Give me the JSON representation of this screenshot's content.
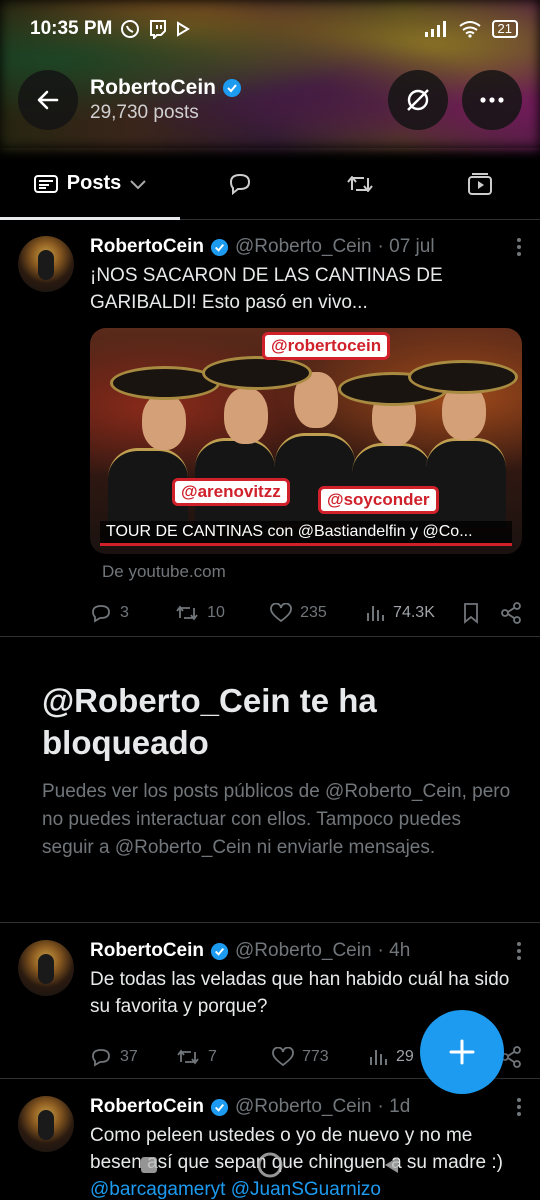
{
  "status_bar": {
    "time": "10:35 PM",
    "battery": "21",
    "icons": [
      "whatsapp-icon",
      "twitch-icon",
      "play-icon",
      "signal-icon",
      "wifi-icon",
      "battery-icon"
    ]
  },
  "profile": {
    "name": "RobertoCein",
    "posts_count": "29,730 posts"
  },
  "tabs": [
    {
      "label": "Posts",
      "icon": "feed-icon",
      "selected": true
    },
    {
      "label": "",
      "icon": "reply-icon"
    },
    {
      "label": "",
      "icon": "repost-icon"
    },
    {
      "label": "",
      "icon": "media-icon"
    }
  ],
  "posts": [
    {
      "name": "RobertoCein",
      "handle": "@Roberto_Cein",
      "time": "· 07 jul",
      "text": "¡NOS SACARON DE LAS CANTINAS DE GARIBALDI! Esto pasó en vivo...",
      "media": {
        "tag_top": "@robertocein",
        "tag_left": "@arenovitzz",
        "tag_right": "@soyconder",
        "caption": "TOUR DE CANTINAS con @Bastiandelfin y @Co...",
        "source": "De youtube.com"
      },
      "replies": "3",
      "reposts": "10",
      "likes": "235",
      "views": "74.3K"
    },
    {
      "name": "RobertoCein",
      "handle": "@Roberto_Cein",
      "time": "· 4h",
      "text": "De todas las veladas que han habido cuál ha sido su favorita y porque?",
      "replies": "37",
      "reposts": "7",
      "likes": "773",
      "views": "29"
    },
    {
      "name": "RobertoCein",
      "handle": "@Roberto_Cein",
      "time": "· 1d",
      "text_plain": "Como peleen ustedes o yo de nuevo y no me besen así que sepan que chinguen a su madre :) ",
      "mention_1": "@barcagameryt",
      "mention_2": "@JuanSGuarnizo"
    }
  ],
  "blocked": {
    "title": "@Roberto_Cein te ha bloqueado",
    "description": "Puedes ver los posts públicos de @Roberto_Cein, pero no puedes interactuar con ellos. Tampoco puedes seguir a @Roberto_Cein ni enviarle mensajes."
  },
  "colors": {
    "accent": "#1d9bf0",
    "background": "#000000",
    "muted": "#71767b",
    "verified": "#1d9bf0"
  }
}
